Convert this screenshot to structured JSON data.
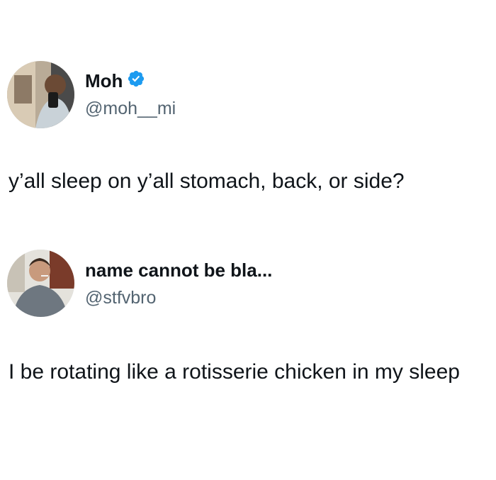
{
  "tweets": [
    {
      "display_name": "Moh",
      "handle": "@moh__mi",
      "verified": true,
      "text": "y’all sleep on y’all stomach, back, or side?"
    },
    {
      "display_name": "name cannot be bla...",
      "handle": "@stfvbro",
      "verified": false,
      "text": "I be rotating like a rotisserie chicken in my sleep"
    }
  ],
  "colors": {
    "text": "#0f1419",
    "handle": "#536471",
    "verified_badge": "#1d9bf0",
    "background": "#ffffff"
  }
}
